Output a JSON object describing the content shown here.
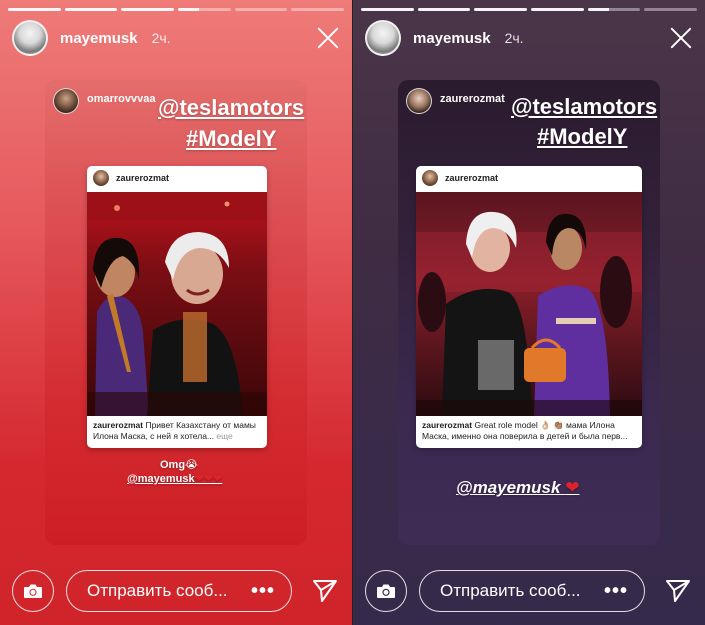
{
  "stories": [
    {
      "progress": {
        "complete": 3,
        "partial": 1,
        "empty": 2,
        "partial_fraction": 0.4
      },
      "username": "mayemusk",
      "time_ago": "2ч.",
      "reposter": "omarrovvvaa",
      "sticker_tags": [
        "@teslamotors",
        "#ModelY"
      ],
      "post": {
        "author": "zaurerozmat",
        "caption_user": "zaurerozmat",
        "caption_text": "Привет Казахстану от мамы Илона Маска, с ней я хотела...",
        "caption_more": "еще"
      },
      "bottom_line1": "Omg😭",
      "bottom_line2": "@mayemusk",
      "hearts": "❤❤❤",
      "reply_placeholder": "Отправить сооб...",
      "more_label": "•••"
    },
    {
      "progress": {
        "complete": 4,
        "partial": 1,
        "empty": 1,
        "partial_fraction": 0.4
      },
      "username": "mayemusk",
      "time_ago": "2ч.",
      "reposter": "zaurerozmat",
      "sticker_tags": [
        "@teslamotors",
        "#ModelY"
      ],
      "post": {
        "author": "zaurerozmat",
        "caption_user": "zaurerozmat",
        "caption_text": "Great role model 👌🏼 👏🏽 мама Илона Маска, именно она поверила в детей и была перв..."
      },
      "bottom_line1": "@mayemusk",
      "hearts": "❤",
      "reply_placeholder": "Отправить сооб...",
      "more_label": "•••"
    }
  ]
}
